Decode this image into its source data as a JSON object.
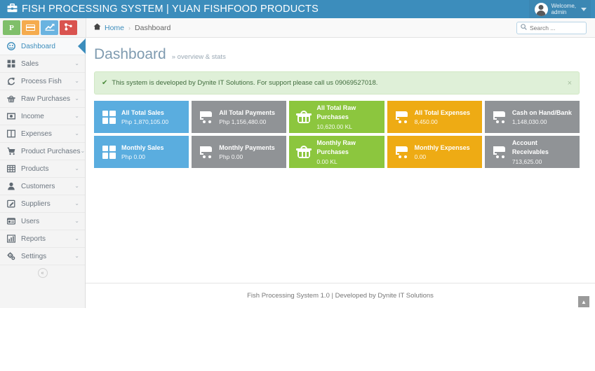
{
  "navbar": {
    "brand_icon": "briefcase-icon",
    "brand": "FISH PROCESSING SYSTEM | YUAN FISHFOOD PRODUCTS",
    "user_label": "Welcome,\nadmin"
  },
  "quick_buttons": [
    {
      "name": "peso-button",
      "icon": "peso-icon",
      "label": "P",
      "color": "#7fbf6a"
    },
    {
      "name": "card-button",
      "icon": "credit-card-icon",
      "label": "",
      "color": "#f5ab4e"
    },
    {
      "name": "chart-button",
      "icon": "chart-line-icon",
      "label": "",
      "color": "#6ab3e0"
    },
    {
      "name": "share-button",
      "icon": "sitemap-icon",
      "label": "",
      "color": "#d9534f"
    }
  ],
  "breadcrumb": {
    "home": "Home",
    "separator": "›",
    "current": "Dashboard"
  },
  "search": {
    "placeholder": "Search ...",
    "value": ""
  },
  "sidebar": {
    "items": [
      {
        "label": "Dashboard",
        "icon": "dashboard-icon",
        "active": true,
        "caret": false
      },
      {
        "label": "Sales",
        "icon": "grid-icon",
        "active": false,
        "caret": true
      },
      {
        "label": "Process Fish",
        "icon": "refresh-icon",
        "active": false,
        "caret": true
      },
      {
        "label": "Raw Purchases",
        "icon": "basket-icon",
        "active": false,
        "caret": true
      },
      {
        "label": "Income",
        "icon": "money-icon",
        "active": false,
        "caret": true
      },
      {
        "label": "Expenses",
        "icon": "columns-icon",
        "active": false,
        "caret": true
      },
      {
        "label": "Product Purchases",
        "icon": "cart-icon",
        "active": false,
        "caret": true
      },
      {
        "label": "Products",
        "icon": "table-icon",
        "active": false,
        "caret": true
      },
      {
        "label": "Customers",
        "icon": "user-icon",
        "active": false,
        "caret": true
      },
      {
        "label": "Suppliers",
        "icon": "edit-square-icon",
        "active": false,
        "caret": true
      },
      {
        "label": "Users",
        "icon": "id-card-icon",
        "active": false,
        "caret": true
      },
      {
        "label": "Reports",
        "icon": "bar-chart-icon",
        "active": false,
        "caret": true
      },
      {
        "label": "Settings",
        "icon": "gears-icon",
        "active": false,
        "caret": true
      }
    ],
    "collapse_icon": "chevron-left-icon",
    "caret_glyph": "⌄"
  },
  "page": {
    "title": "Dashboard",
    "subtitle": "» overview & stats"
  },
  "alert": {
    "icon": "check-icon",
    "text": "This system is developed by Dynite IT Solutions. For support please call us 09069527018.",
    "close_label": "×",
    "bg": "#dff0d8"
  },
  "cards": {
    "rows": [
      [
        {
          "title": "All Total Sales",
          "value": "Php 1,870,105.00",
          "icon": "grid-icon",
          "color": "blue",
          "hex": "#5aaddf"
        },
        {
          "title": "All Total Payments",
          "value": "Php 1,156,480.00",
          "icon": "cart-icon",
          "color": "gray",
          "hex": "#909396"
        },
        {
          "title": "All Total Raw Purchases",
          "value": "10,620.00 KL",
          "icon": "basket-icon",
          "color": "green",
          "hex": "#8cc63e"
        },
        {
          "title": "All Total Expenses",
          "value": "8,450.00",
          "icon": "cart-icon",
          "color": "yellow",
          "hex": "#eeab14"
        },
        {
          "title": "Cash on Hand/Bank",
          "value": "1,148,030.00",
          "icon": "cart-icon",
          "color": "gray",
          "hex": "#909396"
        }
      ],
      [
        {
          "title": "Monthly Sales",
          "value": "Php 0.00",
          "icon": "grid-icon",
          "color": "blue",
          "hex": "#5aaddf"
        },
        {
          "title": "Monthly Payments",
          "value": "Php 0.00",
          "icon": "cart-icon",
          "color": "gray",
          "hex": "#909396"
        },
        {
          "title": "Monthly Raw Purchases",
          "value": "0.00 KL",
          "icon": "basket-icon",
          "color": "green",
          "hex": "#8cc63e"
        },
        {
          "title": "Monthly Expenses",
          "value": "0.00",
          "icon": "cart-icon",
          "color": "yellow",
          "hex": "#eeab14"
        },
        {
          "title": "Account Receivables",
          "value": "713,625.00",
          "icon": "cart-icon",
          "color": "gray",
          "hex": "#909396"
        }
      ]
    ]
  },
  "footer": {
    "text": "Fish Processing System 1.0 | Developed by Dynite IT Solutions",
    "back_to_top_icon": "arrow-up-icon"
  },
  "theme": {
    "navbar_bg": "#3c8dbc",
    "accent": "#3c8dbc",
    "sidebar_bg": "#f4f4f4"
  }
}
